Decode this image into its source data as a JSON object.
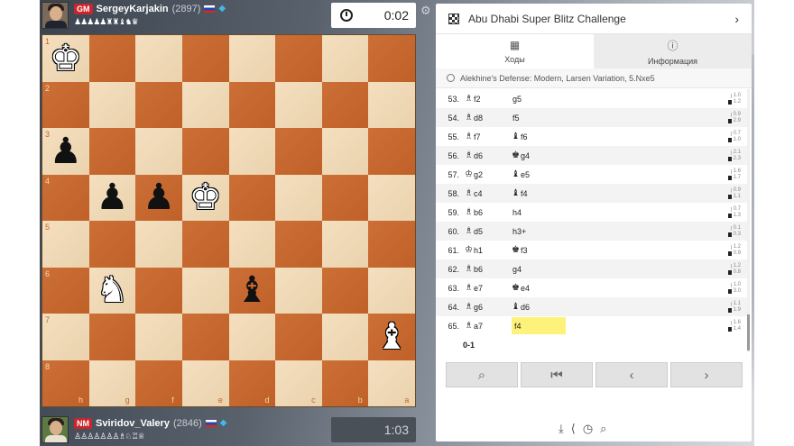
{
  "top_player": {
    "title": "GM",
    "name": "SergeyKarjakin",
    "rating": "(2897)",
    "material": "♟♟♟♟♟♜♜♝♞♛",
    "clock": "0:02"
  },
  "bottom_player": {
    "title": "NM",
    "name": "Sviridov_Valery",
    "rating": "(2846)",
    "material": "♙♙♙♙♙♙♙♗♘♖♕",
    "clock": "1:03"
  },
  "board": {
    "ranks": [
      "1",
      "2",
      "3",
      "4",
      "5",
      "6",
      "7",
      "8"
    ],
    "files": [
      "h",
      "g",
      "f",
      "e",
      "d",
      "c",
      "b",
      "a"
    ]
  },
  "panel": {
    "event_title": "Abu Dhabi Super Blitz Challenge",
    "tab_moves": "Ходы",
    "tab_info": "Информация",
    "opening": "Alekhine's Defense: Modern, Larsen Variation, 5.Nxe5",
    "result": "0-1"
  },
  "moves": [
    {
      "no": "53.",
      "w": "f2",
      "wi": "♗",
      "b": "g5",
      "bi": "",
      "e1": "1.0",
      "e2": "1.2"
    },
    {
      "no": "54.",
      "w": "d8",
      "wi": "♗",
      "b": "f5",
      "bi": "",
      "e1": "0.9",
      "e2": "2.9"
    },
    {
      "no": "55.",
      "w": "f7",
      "wi": "♗",
      "b": "f6",
      "bi": "♝",
      "e1": "0.7",
      "e2": "1.0"
    },
    {
      "no": "56.",
      "w": "d6",
      "wi": "♗",
      "b": "g4",
      "bi": "♚",
      "e1": "2.1",
      "e2": "2.3"
    },
    {
      "no": "57.",
      "w": "g2",
      "wi": "♔",
      "b": "e5",
      "bi": "♝",
      "e1": "1.6",
      "e2": "1.7"
    },
    {
      "no": "58.",
      "w": "c4",
      "wi": "♗",
      "b": "f4",
      "bi": "♝",
      "e1": "0.9",
      "e2": "1.1"
    },
    {
      "no": "59.",
      "w": "b6",
      "wi": "♗",
      "b": "h4",
      "bi": "",
      "e1": "0.7",
      "e2": "1.3"
    },
    {
      "no": "60.",
      "w": "d5",
      "wi": "♗",
      "b": "h3+",
      "bi": "",
      "e1": "0.1",
      "e2": "0.3"
    },
    {
      "no": "61.",
      "w": "h1",
      "wi": "♔",
      "b": "f3",
      "bi": "♚",
      "e1": "1.2",
      "e2": "0.9"
    },
    {
      "no": "62.",
      "w": "b6",
      "wi": "♗",
      "b": "g4",
      "bi": "",
      "e1": "1.2",
      "e2": "0.8"
    },
    {
      "no": "63.",
      "w": "e7",
      "wi": "♗",
      "b": "e4",
      "bi": "♚",
      "e1": "1.0",
      "e2": "3.0"
    },
    {
      "no": "64.",
      "w": "g6",
      "wi": "♗",
      "b": "d6",
      "bi": "♝",
      "e1": "1.1",
      "e2": "1.9"
    },
    {
      "no": "65.",
      "w": "a7",
      "wi": "♗",
      "b": "f4",
      "bi": "",
      "e1": "1.6",
      "e2": "1.4"
    }
  ],
  "pieces": [
    {
      "sq": "0-0",
      "glyph": "♚",
      "color": "w",
      "name": "white-king"
    },
    {
      "sq": "2-0",
      "glyph": "♟",
      "color": "b",
      "name": "black-pawn"
    },
    {
      "sq": "3-1",
      "glyph": "♟",
      "color": "b",
      "name": "black-pawn"
    },
    {
      "sq": "3-2",
      "glyph": "♟",
      "color": "b",
      "name": "black-pawn"
    },
    {
      "sq": "3-3",
      "glyph": "♚",
      "color": "w",
      "name": "black-king-outline"
    },
    {
      "sq": "5-1",
      "glyph": "♞",
      "color": "w",
      "name": "white-knight"
    },
    {
      "sq": "5-4",
      "glyph": "♝",
      "color": "b",
      "name": "black-bishop"
    },
    {
      "sq": "6-7",
      "glyph": "♝",
      "color": "w",
      "name": "white-bishop"
    }
  ]
}
